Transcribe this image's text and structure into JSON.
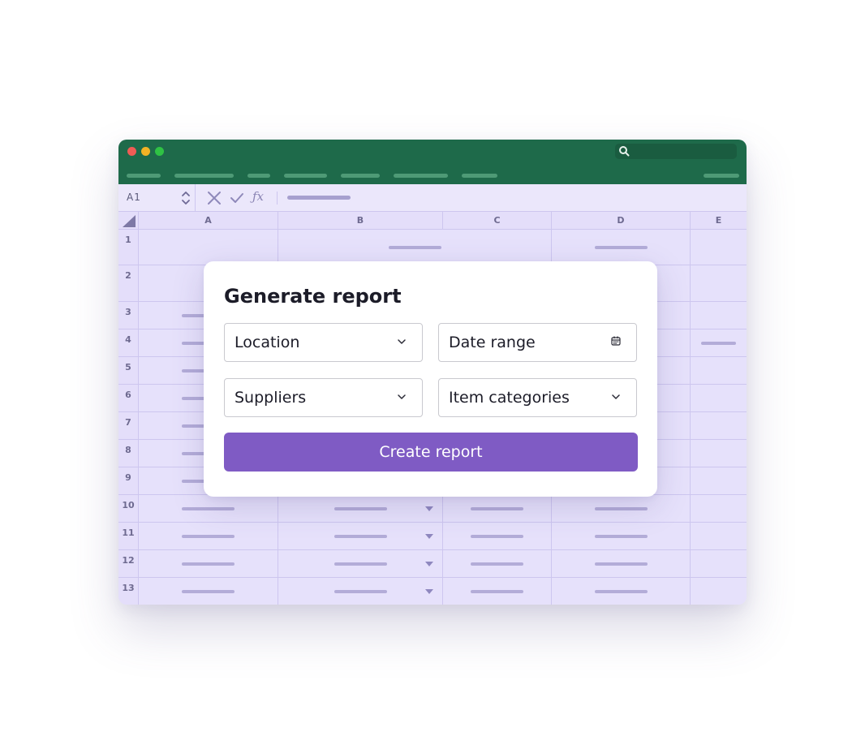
{
  "colors": {
    "titlebar": "#1e6a4a",
    "sheet_bg": "#e9e4fb",
    "gridline": "#cdc6ef",
    "accent_button": "#7f5bc4"
  },
  "spreadsheet": {
    "name_box": "A1",
    "fx_label": "ƒx",
    "column_headers": [
      "A",
      "B",
      "C",
      "D",
      "E"
    ],
    "row_headers": [
      "1",
      "2",
      "3",
      "4",
      "5",
      "6",
      "7",
      "8",
      "9",
      "10",
      "11",
      "12",
      "13"
    ],
    "icons": {
      "search": "search-icon",
      "cancel": "close-icon",
      "confirm": "check-icon",
      "stepper": "stepper-icon",
      "dropdown": "dropdown-arrow-icon"
    }
  },
  "dialog": {
    "title": "Generate report",
    "fields": [
      {
        "label": "Location",
        "icon": "chevron-down-icon"
      },
      {
        "label": "Date range",
        "icon": "calendar-icon"
      },
      {
        "label": "Suppliers",
        "icon": "chevron-down-icon"
      },
      {
        "label": "Item categories",
        "icon": "chevron-down-icon"
      }
    ],
    "submit_label": "Create report"
  }
}
